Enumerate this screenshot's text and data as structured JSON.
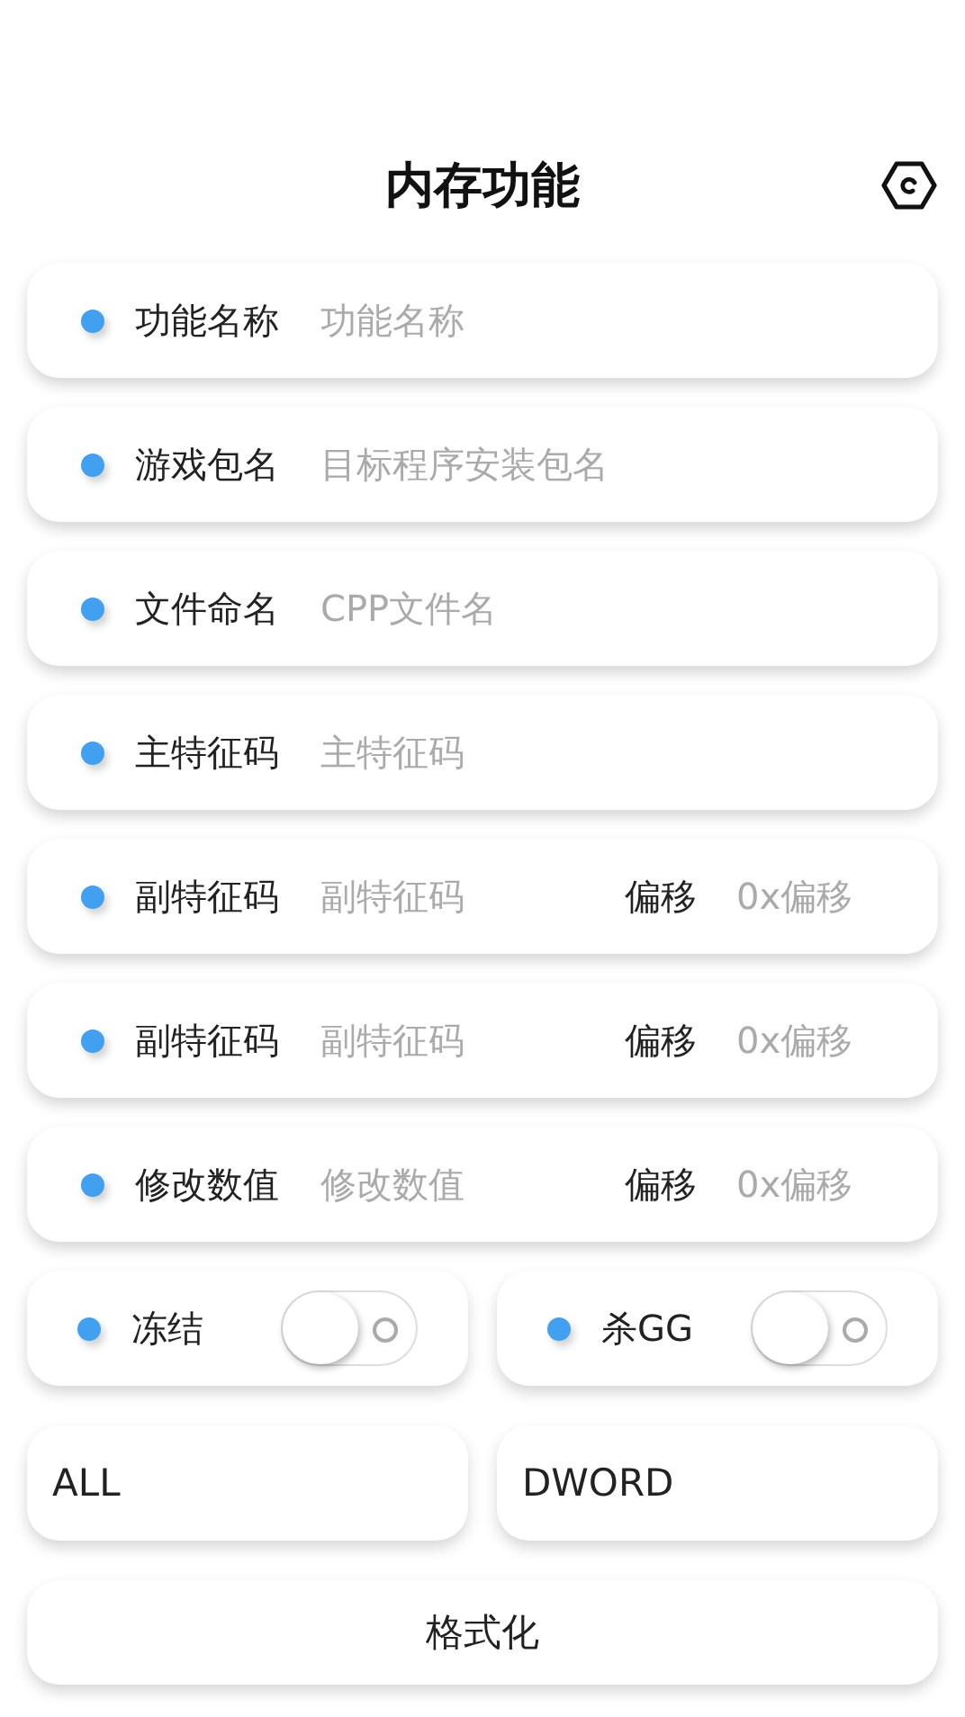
{
  "header": {
    "title": "内存功能"
  },
  "fields": [
    {
      "label": "功能名称",
      "placeholder": "功能名称"
    },
    {
      "label": "游戏包名",
      "placeholder": "目标程序安装包名"
    },
    {
      "label": "文件命名",
      "placeholder": "CPP文件名"
    },
    {
      "label": "主特征码",
      "placeholder": "主特征码"
    },
    {
      "label": "副特征码",
      "placeholder": "副特征码",
      "offset": {
        "label": "偏移",
        "placeholder": "0x偏移"
      }
    },
    {
      "label": "副特征码",
      "placeholder": "副特征码",
      "offset": {
        "label": "偏移",
        "placeholder": "0x偏移"
      }
    },
    {
      "label": "修改数值",
      "placeholder": "修改数值",
      "offset": {
        "label": "偏移",
        "placeholder": "0x偏移"
      }
    }
  ],
  "toggles": [
    {
      "label": "冻结",
      "on": false
    },
    {
      "label": "杀GG",
      "on": false
    }
  ],
  "selects": [
    {
      "value": "ALL"
    },
    {
      "value": "DWORD"
    }
  ],
  "button": {
    "label": "格式化"
  }
}
